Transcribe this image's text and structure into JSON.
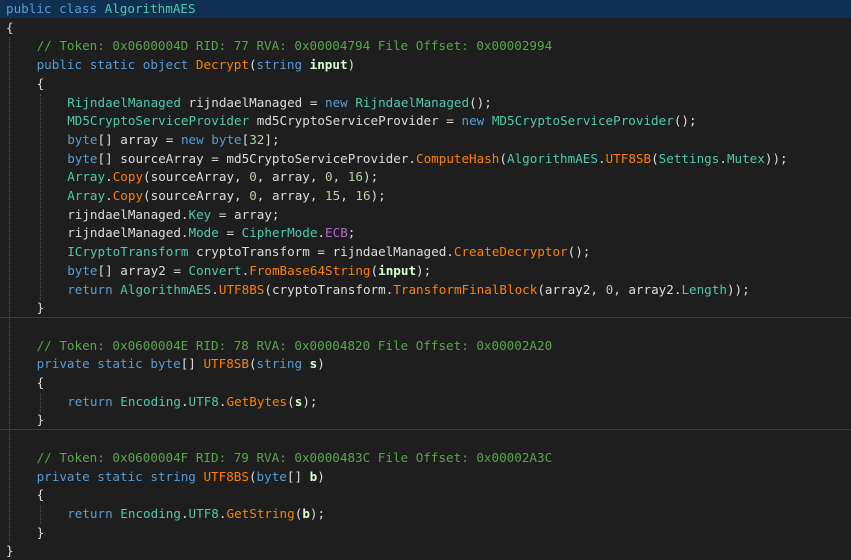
{
  "colors": {
    "background": "#1e1e1e",
    "keyword": "#569cd6",
    "type": "#4ec9b0",
    "method": "#ff8000",
    "property": "#4ec9b0",
    "enum_member": "#b46ac6",
    "comment": "#57a64a",
    "number": "#b5cea8",
    "parameter": "#d7ffd7",
    "plain": "#dcdcdc",
    "highlight": "#0f3050"
  },
  "code_lines": [
    {
      "indent": 0,
      "highlight": true,
      "tokens": [
        {
          "t": "public",
          "c": "kw"
        },
        {
          "t": " "
        },
        {
          "t": "class",
          "c": "kw"
        },
        {
          "t": " "
        },
        {
          "t": "AlgorithmAES",
          "c": "ty"
        }
      ]
    },
    {
      "indent": 0,
      "tokens": [
        {
          "t": "{"
        }
      ]
    },
    {
      "indent": 4,
      "tokens": [
        {
          "t": "// Token: 0x0600004D RID: 77 RVA: 0x00004794 File Offset: 0x00002994",
          "c": "cm"
        }
      ]
    },
    {
      "indent": 4,
      "tokens": [
        {
          "t": "public",
          "c": "kw"
        },
        {
          "t": " "
        },
        {
          "t": "static",
          "c": "kw"
        },
        {
          "t": " "
        },
        {
          "t": "object",
          "c": "kw"
        },
        {
          "t": " "
        },
        {
          "t": "Decrypt",
          "c": "mt"
        },
        {
          "t": "("
        },
        {
          "t": "string",
          "c": "kw"
        },
        {
          "t": " "
        },
        {
          "t": "input",
          "c": "pa"
        },
        {
          "t": ")"
        }
      ]
    },
    {
      "indent": 4,
      "tokens": [
        {
          "t": "{"
        }
      ]
    },
    {
      "indent": 8,
      "tokens": [
        {
          "t": "RijndaelManaged",
          "c": "ty"
        },
        {
          "t": " rijndaelManaged = "
        },
        {
          "t": "new",
          "c": "kw"
        },
        {
          "t": " "
        },
        {
          "t": "RijndaelManaged",
          "c": "ty"
        },
        {
          "t": "();"
        }
      ]
    },
    {
      "indent": 8,
      "tokens": [
        {
          "t": "MD5CryptoServiceProvider",
          "c": "ty"
        },
        {
          "t": " md5CryptoServiceProvider = "
        },
        {
          "t": "new",
          "c": "kw"
        },
        {
          "t": " "
        },
        {
          "t": "MD5CryptoServiceProvider",
          "c": "ty"
        },
        {
          "t": "();"
        }
      ]
    },
    {
      "indent": 8,
      "tokens": [
        {
          "t": "byte",
          "c": "kw"
        },
        {
          "t": "[] array = "
        },
        {
          "t": "new",
          "c": "kw"
        },
        {
          "t": " "
        },
        {
          "t": "byte",
          "c": "kw"
        },
        {
          "t": "["
        },
        {
          "t": "32",
          "c": "nm"
        },
        {
          "t": "];"
        }
      ]
    },
    {
      "indent": 8,
      "tokens": [
        {
          "t": "byte",
          "c": "kw"
        },
        {
          "t": "[] sourceArray = md5CryptoServiceProvider."
        },
        {
          "t": "ComputeHash",
          "c": "mt"
        },
        {
          "t": "("
        },
        {
          "t": "AlgorithmAES",
          "c": "ty"
        },
        {
          "t": "."
        },
        {
          "t": "UTF8SB",
          "c": "mt"
        },
        {
          "t": "("
        },
        {
          "t": "Settings",
          "c": "ty"
        },
        {
          "t": "."
        },
        {
          "t": "Mutex",
          "c": "ty"
        },
        {
          "t": "));"
        }
      ]
    },
    {
      "indent": 8,
      "tokens": [
        {
          "t": "Array",
          "c": "ty"
        },
        {
          "t": "."
        },
        {
          "t": "Copy",
          "c": "mt"
        },
        {
          "t": "(sourceArray, "
        },
        {
          "t": "0",
          "c": "nm"
        },
        {
          "t": ", array, "
        },
        {
          "t": "0",
          "c": "nm"
        },
        {
          "t": ", "
        },
        {
          "t": "16",
          "c": "nm"
        },
        {
          "t": ");"
        }
      ]
    },
    {
      "indent": 8,
      "tokens": [
        {
          "t": "Array",
          "c": "ty"
        },
        {
          "t": "."
        },
        {
          "t": "Copy",
          "c": "mt"
        },
        {
          "t": "(sourceArray, "
        },
        {
          "t": "0",
          "c": "nm"
        },
        {
          "t": ", array, "
        },
        {
          "t": "15",
          "c": "nm"
        },
        {
          "t": ", "
        },
        {
          "t": "16",
          "c": "nm"
        },
        {
          "t": ");"
        }
      ]
    },
    {
      "indent": 8,
      "tokens": [
        {
          "t": "rijndaelManaged."
        },
        {
          "t": "Key",
          "c": "pr"
        },
        {
          "t": " = array;"
        }
      ]
    },
    {
      "indent": 8,
      "tokens": [
        {
          "t": "rijndaelManaged."
        },
        {
          "t": "Mode",
          "c": "pr"
        },
        {
          "t": " = "
        },
        {
          "t": "CipherMode",
          "c": "ty"
        },
        {
          "t": "."
        },
        {
          "t": "ECB",
          "c": "en"
        },
        {
          "t": ";"
        }
      ]
    },
    {
      "indent": 8,
      "tokens": [
        {
          "t": "ICryptoTransform",
          "c": "ty"
        },
        {
          "t": " cryptoTransform = rijndaelManaged."
        },
        {
          "t": "CreateDecryptor",
          "c": "mt"
        },
        {
          "t": "();"
        }
      ]
    },
    {
      "indent": 8,
      "tokens": [
        {
          "t": "byte",
          "c": "kw"
        },
        {
          "t": "[] array2 = "
        },
        {
          "t": "Convert",
          "c": "ty"
        },
        {
          "t": "."
        },
        {
          "t": "FromBase64String",
          "c": "mt"
        },
        {
          "t": "("
        },
        {
          "t": "input",
          "c": "pa"
        },
        {
          "t": ");"
        }
      ]
    },
    {
      "indent": 8,
      "tokens": [
        {
          "t": "return",
          "c": "kw"
        },
        {
          "t": " "
        },
        {
          "t": "AlgorithmAES",
          "c": "ty"
        },
        {
          "t": "."
        },
        {
          "t": "UTF8BS",
          "c": "mt"
        },
        {
          "t": "(cryptoTransform."
        },
        {
          "t": "TransformFinalBlock",
          "c": "mt"
        },
        {
          "t": "(array2, "
        },
        {
          "t": "0",
          "c": "nm"
        },
        {
          "t": ", array2."
        },
        {
          "t": "Length",
          "c": "pr"
        },
        {
          "t": "));"
        }
      ]
    },
    {
      "indent": 4,
      "tokens": [
        {
          "t": "}"
        }
      ]
    },
    {
      "indent": 0,
      "tokens": []
    },
    {
      "indent": 4,
      "tokens": [
        {
          "t": "// Token: 0x0600004E RID: 78 RVA: 0x00004820 File Offset: 0x00002A20",
          "c": "cm"
        }
      ]
    },
    {
      "indent": 4,
      "tokens": [
        {
          "t": "private",
          "c": "kw"
        },
        {
          "t": " "
        },
        {
          "t": "static",
          "c": "kw"
        },
        {
          "t": " "
        },
        {
          "t": "byte",
          "c": "kw"
        },
        {
          "t": "[] "
        },
        {
          "t": "UTF8SB",
          "c": "mt"
        },
        {
          "t": "("
        },
        {
          "t": "string",
          "c": "kw"
        },
        {
          "t": " "
        },
        {
          "t": "s",
          "c": "pa"
        },
        {
          "t": ")"
        }
      ]
    },
    {
      "indent": 4,
      "tokens": [
        {
          "t": "{"
        }
      ]
    },
    {
      "indent": 8,
      "tokens": [
        {
          "t": "return",
          "c": "kw"
        },
        {
          "t": " "
        },
        {
          "t": "Encoding",
          "c": "ty"
        },
        {
          "t": "."
        },
        {
          "t": "UTF8",
          "c": "pr"
        },
        {
          "t": "."
        },
        {
          "t": "GetBytes",
          "c": "mt"
        },
        {
          "t": "("
        },
        {
          "t": "s",
          "c": "pa"
        },
        {
          "t": ");"
        }
      ]
    },
    {
      "indent": 4,
      "tokens": [
        {
          "t": "}"
        }
      ]
    },
    {
      "indent": 0,
      "tokens": []
    },
    {
      "indent": 4,
      "tokens": [
        {
          "t": "// Token: 0x0600004F RID: 79 RVA: 0x0000483C File Offset: 0x00002A3C",
          "c": "cm"
        }
      ]
    },
    {
      "indent": 4,
      "tokens": [
        {
          "t": "private",
          "c": "kw"
        },
        {
          "t": " "
        },
        {
          "t": "static",
          "c": "kw"
        },
        {
          "t": " "
        },
        {
          "t": "string",
          "c": "kw"
        },
        {
          "t": " "
        },
        {
          "t": "UTF8BS",
          "c": "mt"
        },
        {
          "t": "("
        },
        {
          "t": "byte",
          "c": "kw"
        },
        {
          "t": "[] "
        },
        {
          "t": "b",
          "c": "pa"
        },
        {
          "t": ")"
        }
      ]
    },
    {
      "indent": 4,
      "tokens": [
        {
          "t": "{"
        }
      ]
    },
    {
      "indent": 8,
      "tokens": [
        {
          "t": "return",
          "c": "kw"
        },
        {
          "t": " "
        },
        {
          "t": "Encoding",
          "c": "ty"
        },
        {
          "t": "."
        },
        {
          "t": "UTF8",
          "c": "pr"
        },
        {
          "t": "."
        },
        {
          "t": "GetString",
          "c": "mt"
        },
        {
          "t": "("
        },
        {
          "t": "b",
          "c": "pa"
        },
        {
          "t": ");"
        }
      ]
    },
    {
      "indent": 4,
      "tokens": [
        {
          "t": "}"
        }
      ]
    },
    {
      "indent": 0,
      "tokens": [
        {
          "t": "}"
        }
      ]
    }
  ]
}
